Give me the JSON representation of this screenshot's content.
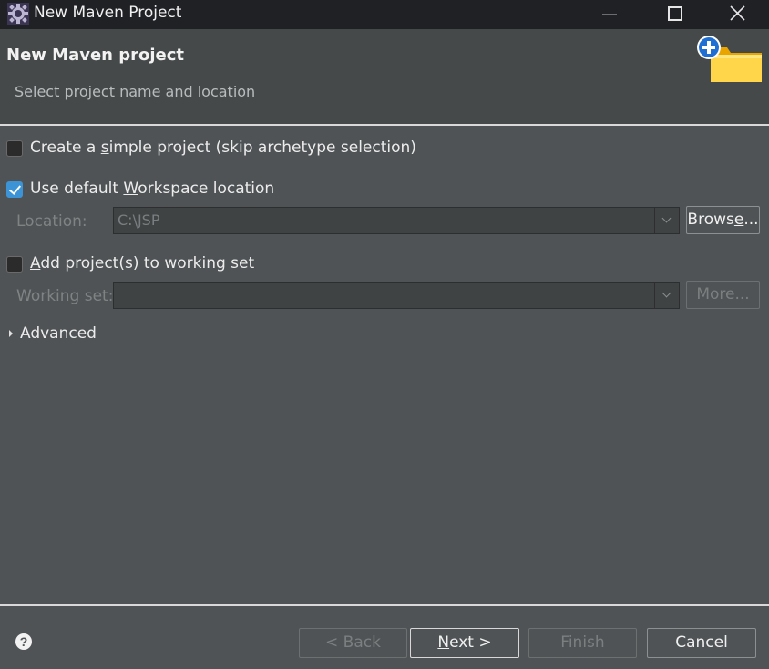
{
  "window": {
    "title": "New Maven Project"
  },
  "header": {
    "title": "New Maven project",
    "subtitle": "Select project name and location"
  },
  "options": {
    "simple_project": {
      "pre": "Create a ",
      "mnemonic": "s",
      "post": "imple project (skip archetype selection)",
      "checked": false
    },
    "default_workspace": {
      "pre": "Use default ",
      "mnemonic": "W",
      "post": "orkspace location",
      "checked": true
    },
    "location": {
      "label": "Location:",
      "value": "C:\\JSP",
      "browse_pre": "Brows",
      "browse_mnemonic": "e",
      "browse_post": "..."
    },
    "working_set_checkbox": {
      "mnemonic": "A",
      "post": "dd project(s) to working set",
      "checked": false
    },
    "working_set": {
      "label": "Working set:",
      "value": "",
      "more_label": "More..."
    },
    "advanced": {
      "label": "Advanced"
    }
  },
  "footer": {
    "back_label": "< Back",
    "next_mnemonic": "N",
    "next_post": "ext >",
    "finish_label": "Finish",
    "cancel_label": "Cancel"
  },
  "icons": {
    "app": "eclipse-gear-icon",
    "header": "new-folder-plus-icon",
    "help": "help-icon"
  },
  "colors": {
    "background": "#4f5355",
    "header_background": "#45494a",
    "titlebar": "#202125",
    "accent": "#3c94d7"
  }
}
